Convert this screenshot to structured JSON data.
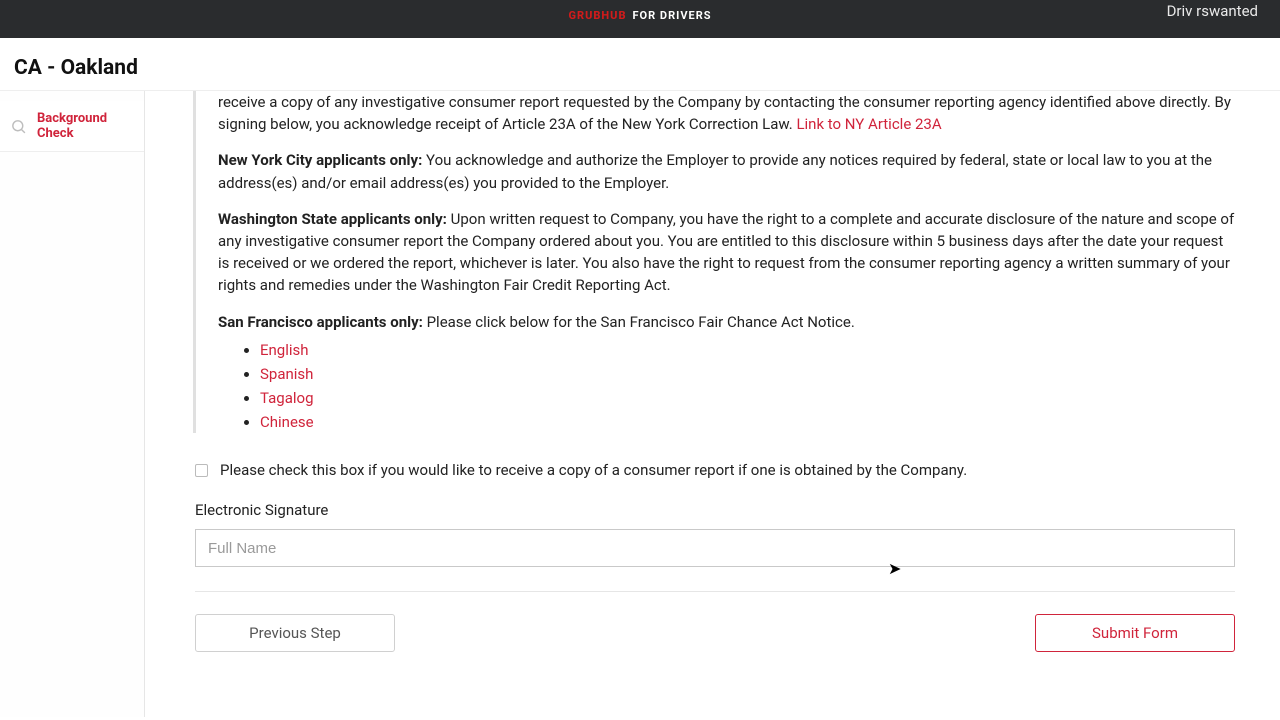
{
  "topbar": {
    "brand_red": "GRUBHUB",
    "brand_white": "FOR DRIVERS",
    "right_text": "Driv rswanted"
  },
  "subheader": {
    "title": "CA - Oakland"
  },
  "sidebar": {
    "items": [
      {
        "label": "Background Check"
      }
    ]
  },
  "content": {
    "ny_trail": "receive a copy of any investigative consumer report requested by the Company by contacting the consumer reporting agency identified above directly. By signing below, you acknowledge receipt of Article 23A of the New York Correction Law. ",
    "ny_link": "Link to NY Article 23A",
    "nyc_bold": "New York City applicants only:",
    "nyc_text": " You acknowledge and authorize the Employer to provide any notices required by federal, state or local law to you at the address(es) and/or email address(es) you provided to the Employer.",
    "wa_bold": "Washington State applicants only:",
    "wa_text": " Upon written request to Company, you have the right to a complete and accurate disclosure of the nature and scope of any investigative consumer report the Company ordered about you. You are entitled to this disclosure within 5 business days after the date your request is received or we ordered the report, whichever is later. You also have the right to request from the consumer reporting agency a written summary of your rights and remedies under the Washington Fair Credit Reporting Act.",
    "sf_bold": "San Francisco applicants only:",
    "sf_text": " Please click below for the San Francisco Fair Chance Act Notice.",
    "languages": [
      "English",
      "Spanish",
      "Tagalog",
      "Chinese"
    ]
  },
  "consent": {
    "label": "Please check this box if you would like to receive a copy of a consumer report if one is obtained by the Company."
  },
  "signature": {
    "label": "Electronic Signature",
    "placeholder": "Full Name",
    "value": ""
  },
  "buttons": {
    "prev": "Previous Step",
    "submit": "Submit Form"
  }
}
